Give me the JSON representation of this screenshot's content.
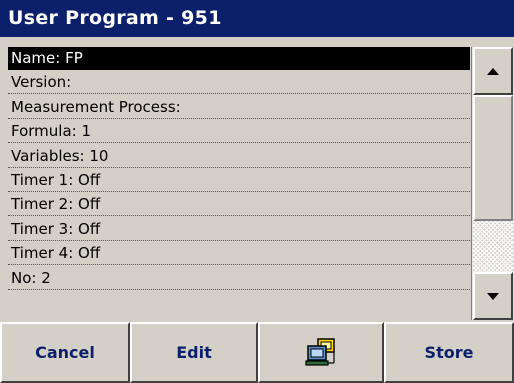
{
  "window": {
    "title": "User Program - 951"
  },
  "list": {
    "items": [
      {
        "label": "Name: FP",
        "selected": true
      },
      {
        "label": "Version:",
        "selected": false
      },
      {
        "label": "Measurement Process:",
        "selected": false
      },
      {
        "label": "Formula: 1",
        "selected": false
      },
      {
        "label": "Variables: 10",
        "selected": false
      },
      {
        "label": "Timer 1: Off",
        "selected": false
      },
      {
        "label": "Timer 2: Off",
        "selected": false
      },
      {
        "label": "Timer 3: Off",
        "selected": false
      },
      {
        "label": "Timer 4: Off",
        "selected": false
      },
      {
        "label": "No: 2",
        "selected": false
      }
    ]
  },
  "scrollbar": {
    "up_icon": "arrow-up-icon",
    "down_icon": "arrow-down-icon"
  },
  "toolbar": {
    "cancel_label": "Cancel",
    "edit_label": "Edit",
    "network_icon": "network-computer-icon",
    "store_label": "Store"
  },
  "colors": {
    "title_bg": "#0b1f6b",
    "title_text": "#ffffff",
    "selected_bg": "#000000",
    "button_text": "#0b1f6b",
    "panel_bg": "#d4d0c8"
  }
}
